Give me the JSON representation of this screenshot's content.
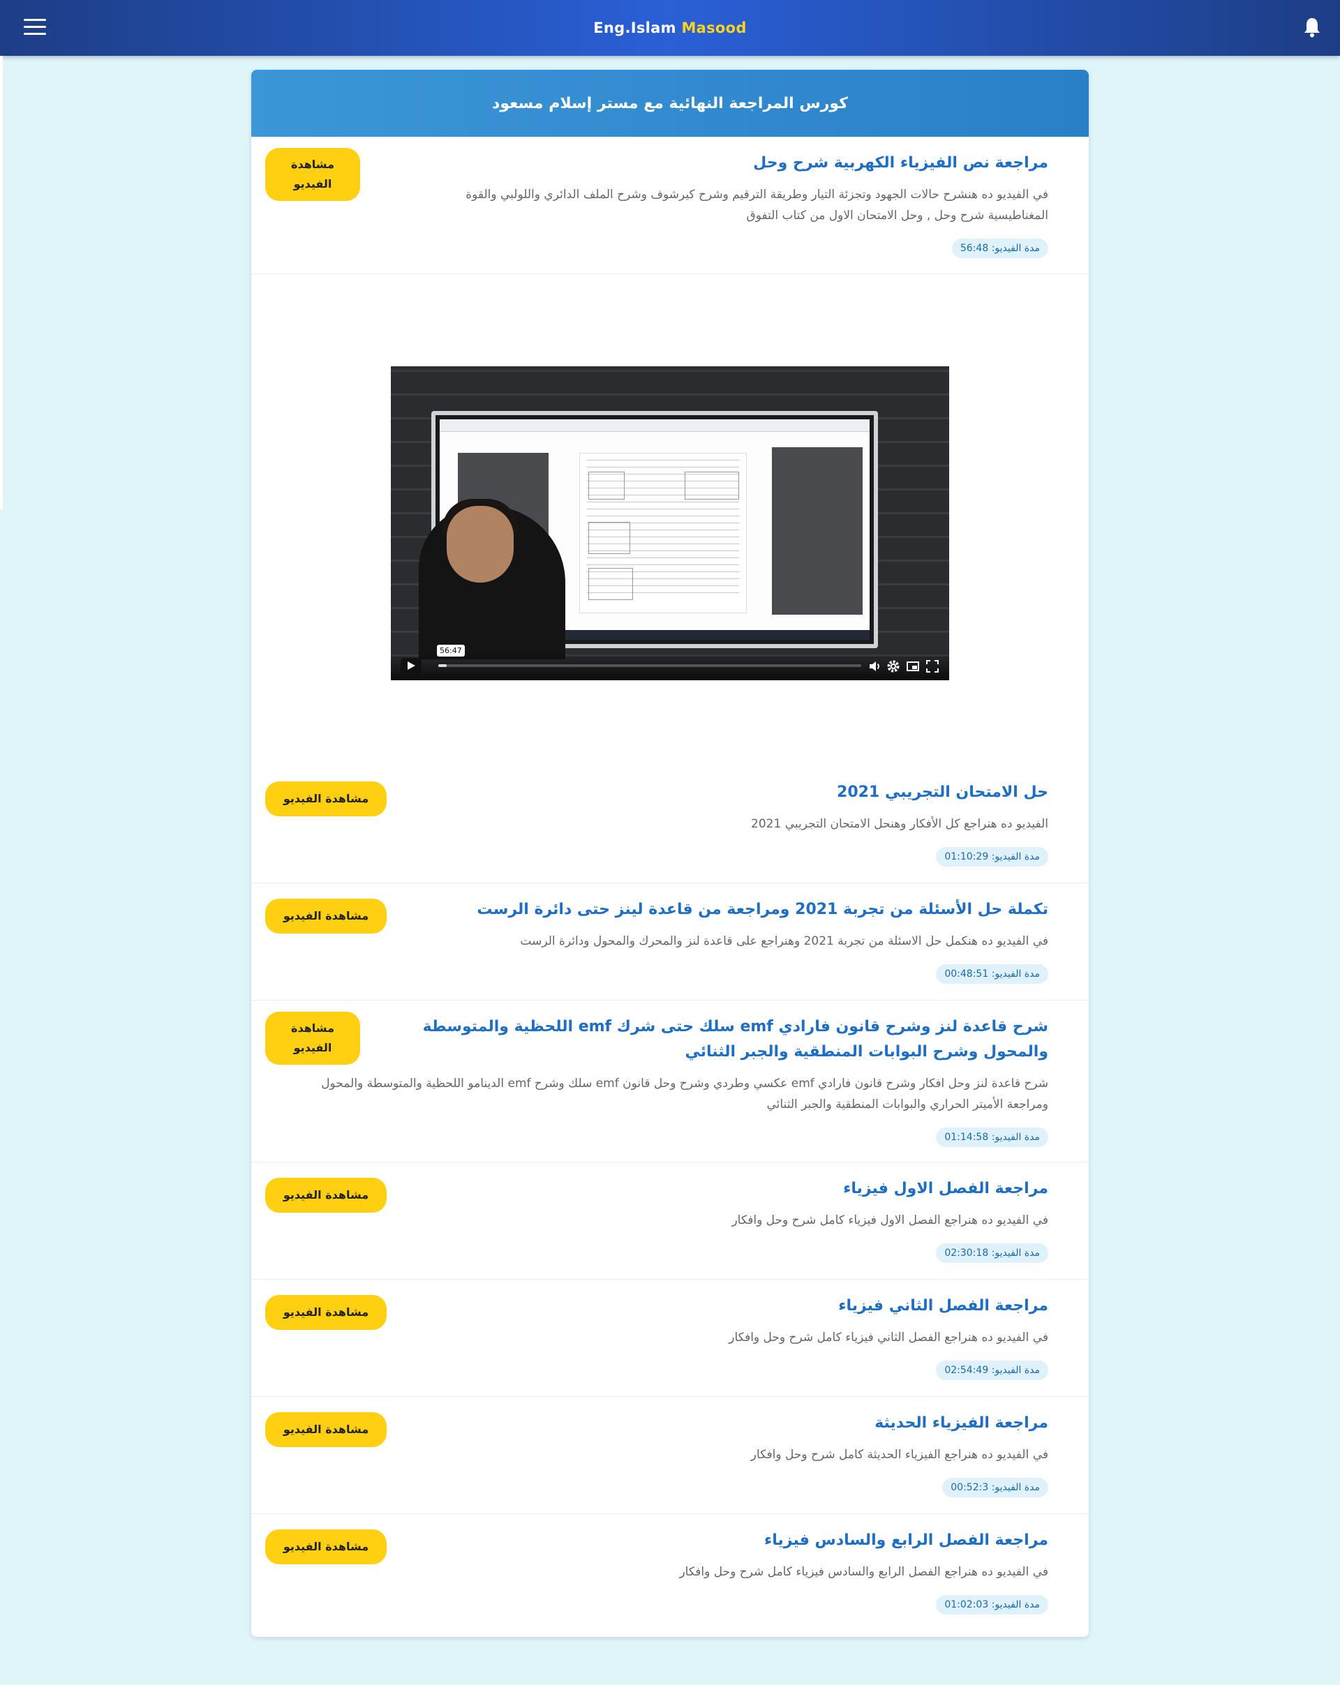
{
  "header": {
    "brand_prefix": "Eng.Islam",
    "brand_accent": "Masood"
  },
  "course": {
    "title": "كورس المراجعة النهائية مع مستر إسلام مسعود"
  },
  "lessons": [
    {
      "title": "مراجعة نص الفيزياء الكهربية شرح وحل",
      "description": "في الفيديو ده هنشرح حالات الجهود وتجزئة التيار وطريقة الترقيم وشرح كيرشوف وشرح الملف الدائري واللولبي والقوة المغناطيسية شرح وحل , وحل الامتحان الاول من كتاب التفوق",
      "duration": "مدة الفيديو: 56:48",
      "button": "مشاهدة الفيديو"
    },
    {
      "title": "حل الامتحان التجريبي 2021",
      "description": "الفيديو ده هنراجع كل الأفكار وهنحل الامتحان التجريبي 2021",
      "duration": "مدة الفيديو: 01:10:29",
      "button": "مشاهدة الفيديو"
    },
    {
      "title": "تكملة حل الأسئلة من تجربة 2021 ومراجعة من قاعدة لينز حتى دائرة الرست",
      "description": "في الفيديو ده هنكمل حل الاسئلة من تجربة 2021 وهنراجع على قاعدة لنز والمحرك والمحول ودائرة الرست",
      "duration": "مدة الفيديو: 00:48:51",
      "button": "مشاهدة الفيديو"
    },
    {
      "title": "شرح قاعدة لنز وشرح قانون فارادي emf سلك حتى شرك emf اللحظية والمتوسطة والمحول وشرح البوابات المنطقية والجبر الثنائي",
      "description": "شرح قاعدة لنز وحل افكار وشرح قانون فارادي emf عكسي وطردي وشرح وحل قانون emf سلك وشرح emf الدينامو اللحظية والمتوسطة والمحول ومراجعة الأميتر الحراري والبوابات المنطقية والجبر الثنائي",
      "duration": "مدة الفيديو: 01:14:58",
      "button": "مشاهدة الفيديو"
    },
    {
      "title": "مراجعة الفصل الاول فيزياء",
      "description": "في الفيديو ده هنراجع الفصل الاول فيزياء كامل شرح وحل وافكار",
      "duration": "مدة الفيديو: 02:30:18",
      "button": "مشاهدة الفيديو"
    },
    {
      "title": "مراجعة الفصل الثاني فيزياء",
      "description": "في الفيديو ده هنراجع الفصل الثاني فيزياء كامل شرح وحل وافكار",
      "duration": "مدة الفيديو: 02:54:49",
      "button": "مشاهدة الفيديو"
    },
    {
      "title": "مراجعة الفيزياء الحديثة",
      "description": "في الفيديو ده هنراجع الفيزياء الحديثة كامل شرح وحل وافكار",
      "duration": "مدة الفيديو: 00:52:3",
      "button": "مشاهدة الفيديو"
    },
    {
      "title": "مراجعة الفصل الرابع والسادس فيزياء",
      "description": "في الفيديو ده هنراجع الفصل الرابع والسادس فيزياء كامل شرح وحل وافكار",
      "duration": "مدة الفيديو: 01:02:03",
      "button": "مشاهدة الفيديو"
    }
  ],
  "player": {
    "hover_time": "56:47",
    "progress": 0.02
  },
  "icons": {
    "menu": "hamburger-menu-icon",
    "notifications": "bell-icon",
    "play": "play-icon",
    "volume": "volume-icon",
    "settings": "gear-icon",
    "pip": "picture-in-picture-icon",
    "fullscreen": "fullscreen-icon"
  },
  "colors": {
    "header_bg": "#2a5fd6",
    "brand_accent": "#ffd21f",
    "card_header": "#3b97d8",
    "lesson_title": "#1e6fc4",
    "button_bg": "#ffd012",
    "duration_bg": "#dff1fa",
    "page_bg": "#dff5f8"
  }
}
